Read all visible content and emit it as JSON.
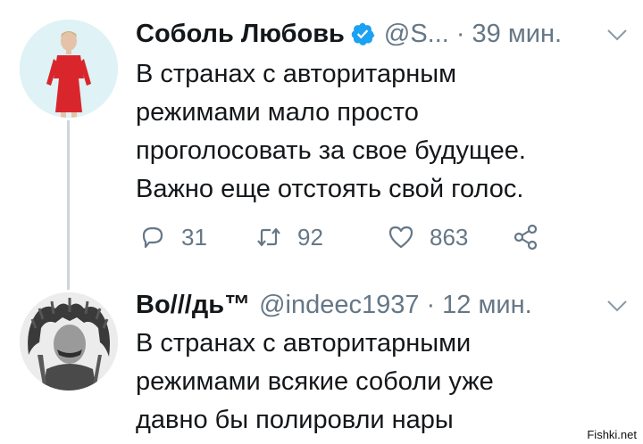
{
  "tweets": [
    {
      "author": "Соболь Любовь",
      "handle": "@S...",
      "separator": "·",
      "time": "39 мин.",
      "verified": true,
      "text_lines": [
        "В странах с авторитарным",
        "режимами мало просто",
        "проголосовать за свое будущее.",
        "Важно еще отстоять свой голос."
      ],
      "replies": "31",
      "retweets": "92",
      "likes": "863"
    },
    {
      "author": "Во///дь™",
      "handle": "@indeec1937",
      "separator": "·",
      "time": "12 мин.",
      "verified": false,
      "text_lines": [
        "В странах с авторитарными",
        "режимами всякие соболи уже",
        "давно бы полировли нары"
      ]
    }
  ],
  "icons": {
    "verified": "verified-badge-icon",
    "menu": "chevron-down-icon",
    "reply": "reply-icon",
    "retweet": "retweet-icon",
    "like": "heart-icon",
    "share": "share-icon"
  },
  "colors": {
    "text": "#14171a",
    "muted": "#657786",
    "verified": "#1da1f2",
    "thread_line": "#ccd6dd"
  },
  "watermark": "Fishki.net"
}
